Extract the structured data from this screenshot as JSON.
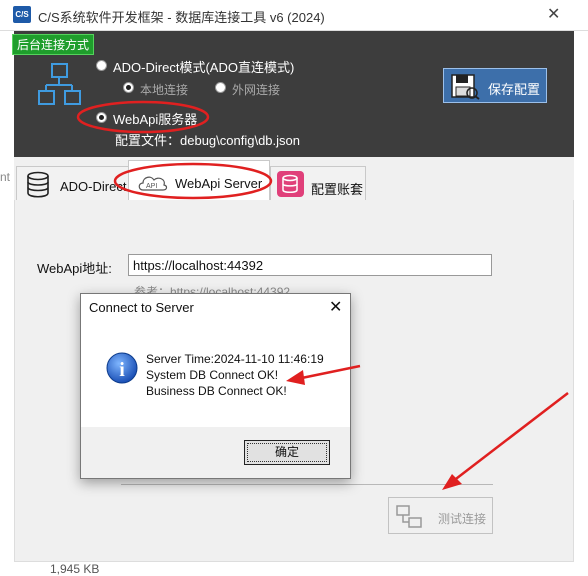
{
  "window": {
    "title": "C/S系统软件开发框架 - 数据库连接工具 v6 (2024)",
    "app_icon_text": "C/S",
    "close_symbol": "✕"
  },
  "header": {
    "section_label": "后台连接方式",
    "option_ado": "ADO-Direct模式(ADO直连模式)",
    "sub_local": "本地连接",
    "sub_external": "外网连接",
    "option_webapi": "WebApi服务器",
    "config_file": "配置文件：debug\\config\\db.json",
    "save_button": "保存配置"
  },
  "tabs": [
    {
      "label": "ADO-Direct"
    },
    {
      "label": "WebApi Server"
    },
    {
      "label": "配置账套"
    }
  ],
  "tab_icon_api_text": "API",
  "webapi": {
    "label": "WebApi地址:",
    "url_value": "https://localhost:44392",
    "reference": "参考：https://localhost:44392",
    "test_button": "测试连接"
  },
  "left_edge_text": "nt",
  "status": {
    "file_size": "1,945 KB"
  },
  "dialog": {
    "title": "Connect to Server",
    "close_symbol": "✕",
    "line1": "Server Time:2024-11-10 11:46:19",
    "line2": "System DB Connect OK!",
    "line3": "Business DB Connect OK!",
    "ok_button": "确定",
    "icon_letter": "i"
  },
  "colors": {
    "header_bg": "#3d3d3d",
    "green_label": "#1f9e2c",
    "save_button_bg": "#3d6faa",
    "annotation_red": "#e02020"
  }
}
